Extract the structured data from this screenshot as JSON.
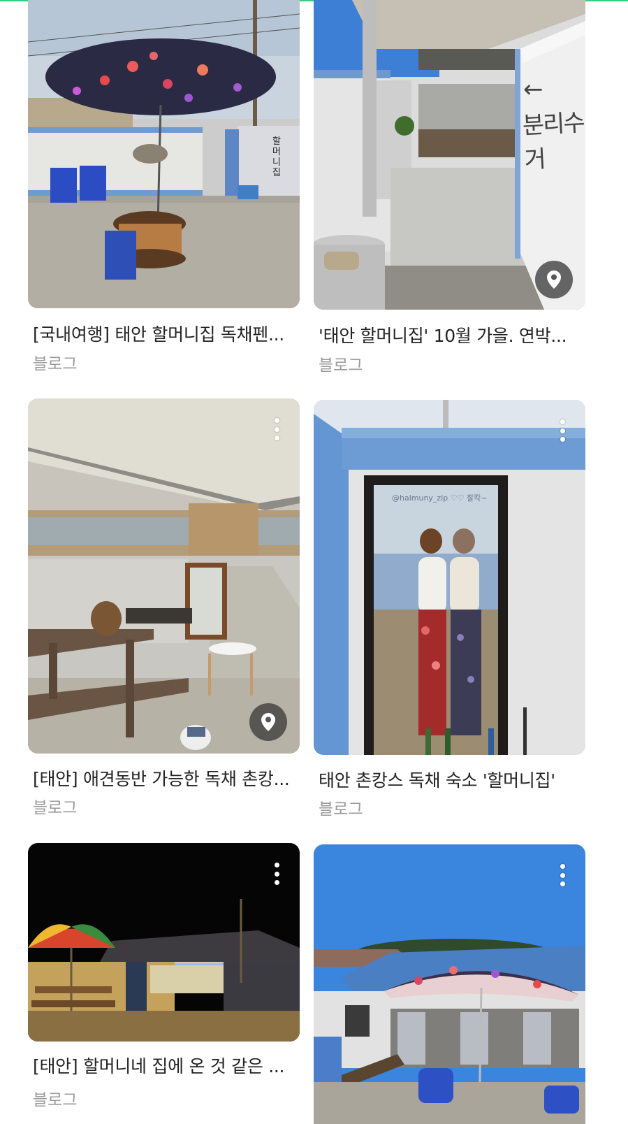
{
  "colors": {
    "accent_line": "#2bd17e",
    "pin_bg": "#3c3c3c"
  },
  "results": [
    {
      "title": "[국내여행] 태안 할머니집 독채펜션 후기",
      "title_visible": "[국내여행] 태안 할머니집 독채펜...",
      "source": "블로그",
      "badge_icon": "location-pin-icon"
    },
    {
      "title": "'태안 할머니집' 10월 가을. 연박 후기",
      "title_visible": "'태안 할머니집' 10월 가을. 연박...",
      "source": "블로그",
      "badge_icon": "location-pin-icon"
    },
    {
      "title": "[태안] 애견동반 가능한 독채 촌캉스",
      "title_visible": "[태안] 애견동반 가능한 독채 촌캉...",
      "source": "블로그",
      "badge_icon": "location-pin-icon"
    },
    {
      "title": "태안 촌캉스 독채 숙소 '할머니집'",
      "title_visible": "태안 촌캉스 독채 숙소 '할머니집'",
      "source": "블로그"
    },
    {
      "title": "[태안] 할머니네 집에 온 것 같은 ...",
      "title_visible": "[태안] 할머니네 집에 온 것 같은 ...",
      "source": "블로그"
    },
    {
      "title": "",
      "title_visible": "",
      "source": ""
    }
  ],
  "image_text": {
    "wall_sign": "분리수거",
    "gate_sign": "할머니집",
    "mirror_caption": "@halmuny_zip ♡♡ 찰칵~"
  }
}
